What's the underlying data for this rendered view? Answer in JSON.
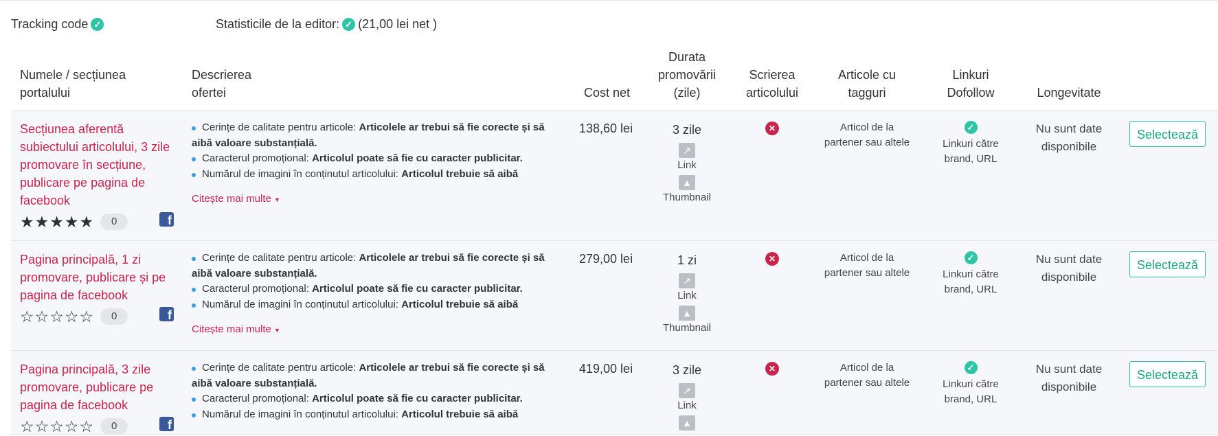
{
  "summary": {
    "tracking_label": "Tracking code",
    "stats_label": "Statisticile de la editor:",
    "stats_value": "(21,00 lei net )"
  },
  "headers": {
    "name_1": "Numele / secțiunea",
    "name_2": "portalului",
    "desc_1": "Descrierea",
    "desc_2": "ofertei",
    "cost": "Cost net",
    "dur_1": "Durata",
    "dur_2": "promovării",
    "dur_3": "(zile)",
    "writing_1": "Scrierea",
    "writing_2": "articolului",
    "tags_1": "Articole cu",
    "tags_2": "tagguri",
    "links_1": "Linkuri",
    "links_2": "Dofollow",
    "longevity": "Longevitate"
  },
  "colors": {
    "accent_green": "#2ec4a5",
    "accent_red": "#c8254c",
    "facebook": "#3b5998",
    "bullet_blue": "#3a9ee0"
  },
  "offers": [
    {
      "title_lines": [
        "Secțiunea aferentă",
        "subiectului articolului, 3 zile",
        "promovare în secțiune,",
        "publicare pe pagina de",
        "facebook"
      ],
      "rating_stars": 5,
      "rating_filled": true,
      "rating_count": "0",
      "desc": [
        {
          "label": "Cerințe de calitate pentru articole:",
          "value_1": "Articolele ar trebui să fie corecte și să",
          "value_2": "aibă valoare substanțială."
        },
        {
          "label": "Caracterul promoțional:",
          "value": "Articolul poate să fie cu caracter publicitar."
        },
        {
          "label": "Numărul de imagini în conținutul articolului:",
          "value": "Articolul trebuie să aibă"
        }
      ],
      "more": "Citește mai multe",
      "cost": "138,60 lei",
      "duration": "3 zile",
      "dur_link": "Link",
      "dur_thumb": "Thumbnail",
      "writing_icon": "x-circle-icon",
      "tags_1": "Articol de la",
      "tags_2": "partener sau altele",
      "links_1": "Linkuri către",
      "links_2": "brand, URL",
      "longevity_1": "Nu sunt date",
      "longevity_2": "disponibile",
      "button": "Selectează"
    },
    {
      "title_lines": [
        "Pagina principală, 1 zi",
        "promovare, publicare și pe",
        "pagina de facebook"
      ],
      "rating_stars": 5,
      "rating_filled": false,
      "rating_count": "0",
      "desc": [
        {
          "label": "Cerințe de calitate pentru articole:",
          "value_1": "Articolele ar trebui să fie corecte și să",
          "value_2": "aibă valoare substanțială."
        },
        {
          "label": "Caracterul promoțional:",
          "value": "Articolul poate să fie cu caracter publicitar."
        },
        {
          "label": "Numărul de imagini în conținutul articolului:",
          "value": "Articolul trebuie să aibă"
        }
      ],
      "more": "Citește mai multe",
      "cost": "279,00 lei",
      "duration": "1 zi",
      "dur_link": "Link",
      "dur_thumb": "Thumbnail",
      "writing_icon": "x-circle-icon",
      "tags_1": "Articol de la",
      "tags_2": "partener sau altele",
      "links_1": "Linkuri către",
      "links_2": "brand, URL",
      "longevity_1": "Nu sunt date",
      "longevity_2": "disponibile",
      "button": "Selectează"
    },
    {
      "title_lines": [
        "Pagina principală, 3 zile",
        "promovare, publicare pe",
        "pagina de facebook"
      ],
      "rating_stars": 5,
      "rating_filled": false,
      "rating_count": "0",
      "desc": [
        {
          "label": "Cerințe de calitate pentru articole:",
          "value_1": "Articolele ar trebui să fie corecte și să",
          "value_2": "aibă valoare substanțială."
        },
        {
          "label": "Caracterul promoțional:",
          "value": "Articolul poate să fie cu caracter publicitar."
        },
        {
          "label": "Numărul de imagini în conținutul articolului:",
          "value": "Articolul trebuie să aibă"
        }
      ],
      "cost": "419,00 lei",
      "duration": "3 zile",
      "dur_link": "Link",
      "writing_icon": "x-circle-icon",
      "tags_1": "Articol de la",
      "tags_2": "partener sau altele",
      "links_1": "Linkuri către",
      "links_2": "brand, URL",
      "longevity_1": "Nu sunt date",
      "longevity_2": "disponibile",
      "button": "Selectează"
    }
  ]
}
